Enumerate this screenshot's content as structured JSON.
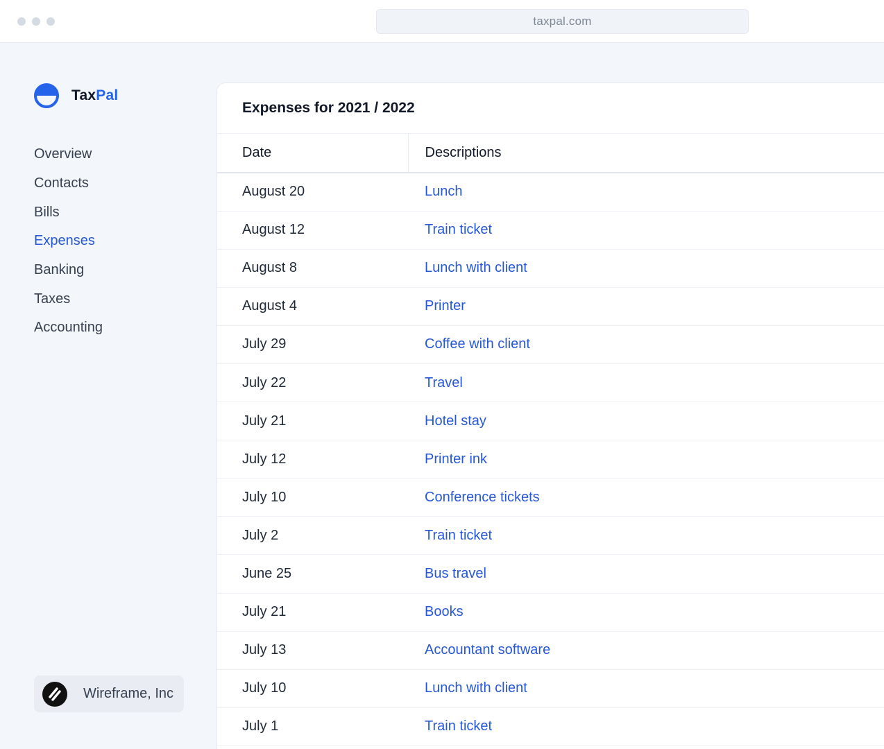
{
  "browser": {
    "url": "taxpal.com"
  },
  "brand": {
    "name_primary": "Tax",
    "name_accent": "Pal",
    "accent_color": "#2563eb"
  },
  "sidebar": {
    "items": [
      {
        "label": "Overview",
        "active": false
      },
      {
        "label": "Contacts",
        "active": false
      },
      {
        "label": "Bills",
        "active": false
      },
      {
        "label": "Expenses",
        "active": true
      },
      {
        "label": "Banking",
        "active": false
      },
      {
        "label": "Taxes",
        "active": false
      },
      {
        "label": "Accounting",
        "active": false
      }
    ],
    "organization": {
      "name": "Wireframe, Inc",
      "icon": "wireframe-logo-icon"
    }
  },
  "main": {
    "title": "Expenses for 2021 / 2022",
    "table": {
      "columns": [
        "Date",
        "Descriptions"
      ],
      "rows": [
        {
          "date": "August 20",
          "description": "Lunch"
        },
        {
          "date": "August 12",
          "description": "Train ticket"
        },
        {
          "date": "August 8",
          "description": "Lunch with client"
        },
        {
          "date": "August 4",
          "description": "Printer"
        },
        {
          "date": "July 29",
          "description": "Coffee with client"
        },
        {
          "date": "July 22",
          "description": "Travel"
        },
        {
          "date": "July 21",
          "description": "Hotel stay"
        },
        {
          "date": "July 12",
          "description": "Printer ink"
        },
        {
          "date": "July 10",
          "description": "Conference tickets"
        },
        {
          "date": "July 2",
          "description": "Train ticket"
        },
        {
          "date": "June 25",
          "description": "Bus travel"
        },
        {
          "date": "July 21",
          "description": "Books"
        },
        {
          "date": "July 13",
          "description": "Accountant software"
        },
        {
          "date": "July 10",
          "description": "Lunch with client"
        },
        {
          "date": "July 1",
          "description": "Train ticket"
        }
      ]
    }
  },
  "colors": {
    "link": "#2557d6",
    "background": "#f3f6fa",
    "panel": "#ffffff"
  }
}
